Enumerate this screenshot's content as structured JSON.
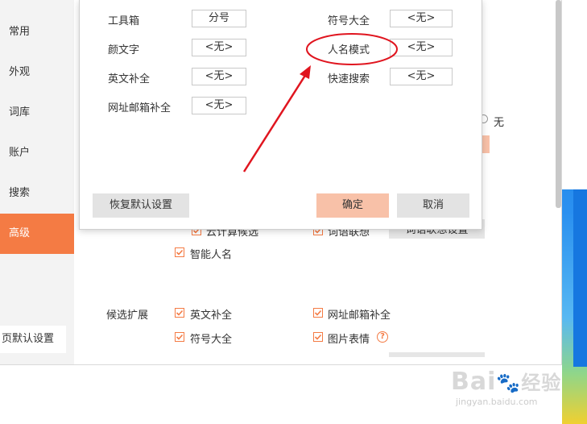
{
  "sidebar": {
    "items": [
      {
        "label": "常用"
      },
      {
        "label": "外观"
      },
      {
        "label": "词库"
      },
      {
        "label": "账户"
      },
      {
        "label": "搜索"
      },
      {
        "label": "高级"
      }
    ],
    "reset_label": "页默认设置"
  },
  "background": {
    "radio_none": "无",
    "cloud_calc_label": "云计算候选",
    "word_emotion_label": "词语联想",
    "word_emotion_button": "词语联想设置",
    "smart_name_label": "智能人名",
    "candidate_ext_title": "候选扩展",
    "ext_items": [
      {
        "label": "英文补全"
      },
      {
        "label": "网址邮箱补全"
      },
      {
        "label": "符号大全"
      },
      {
        "label": "图片表情"
      }
    ],
    "help_icon": "?"
  },
  "dialog": {
    "rows_left": [
      {
        "label": "工具箱",
        "key": "分号"
      },
      {
        "label": "颜文字",
        "key": "<无>"
      },
      {
        "label": "英文补全",
        "key": "<无>"
      },
      {
        "label": "网址邮箱补全",
        "key": "<无>"
      }
    ],
    "rows_right": [
      {
        "label": "符号大全",
        "key": "<无>"
      },
      {
        "label": "人名模式",
        "key": "<无>"
      },
      {
        "label": "快速搜索",
        "key": "<无>"
      }
    ],
    "reset_button": "恢复默认设置",
    "ok_button": "确定",
    "cancel_button": "取消"
  },
  "annotation": {
    "color": "#e0151f"
  },
  "colors": {
    "accent": "#f47b44",
    "ok_bg": "#f8c1a8"
  },
  "watermark": {
    "brand": "Bai",
    "brand2": "经验",
    "url": "jingyan.baidu.com"
  }
}
